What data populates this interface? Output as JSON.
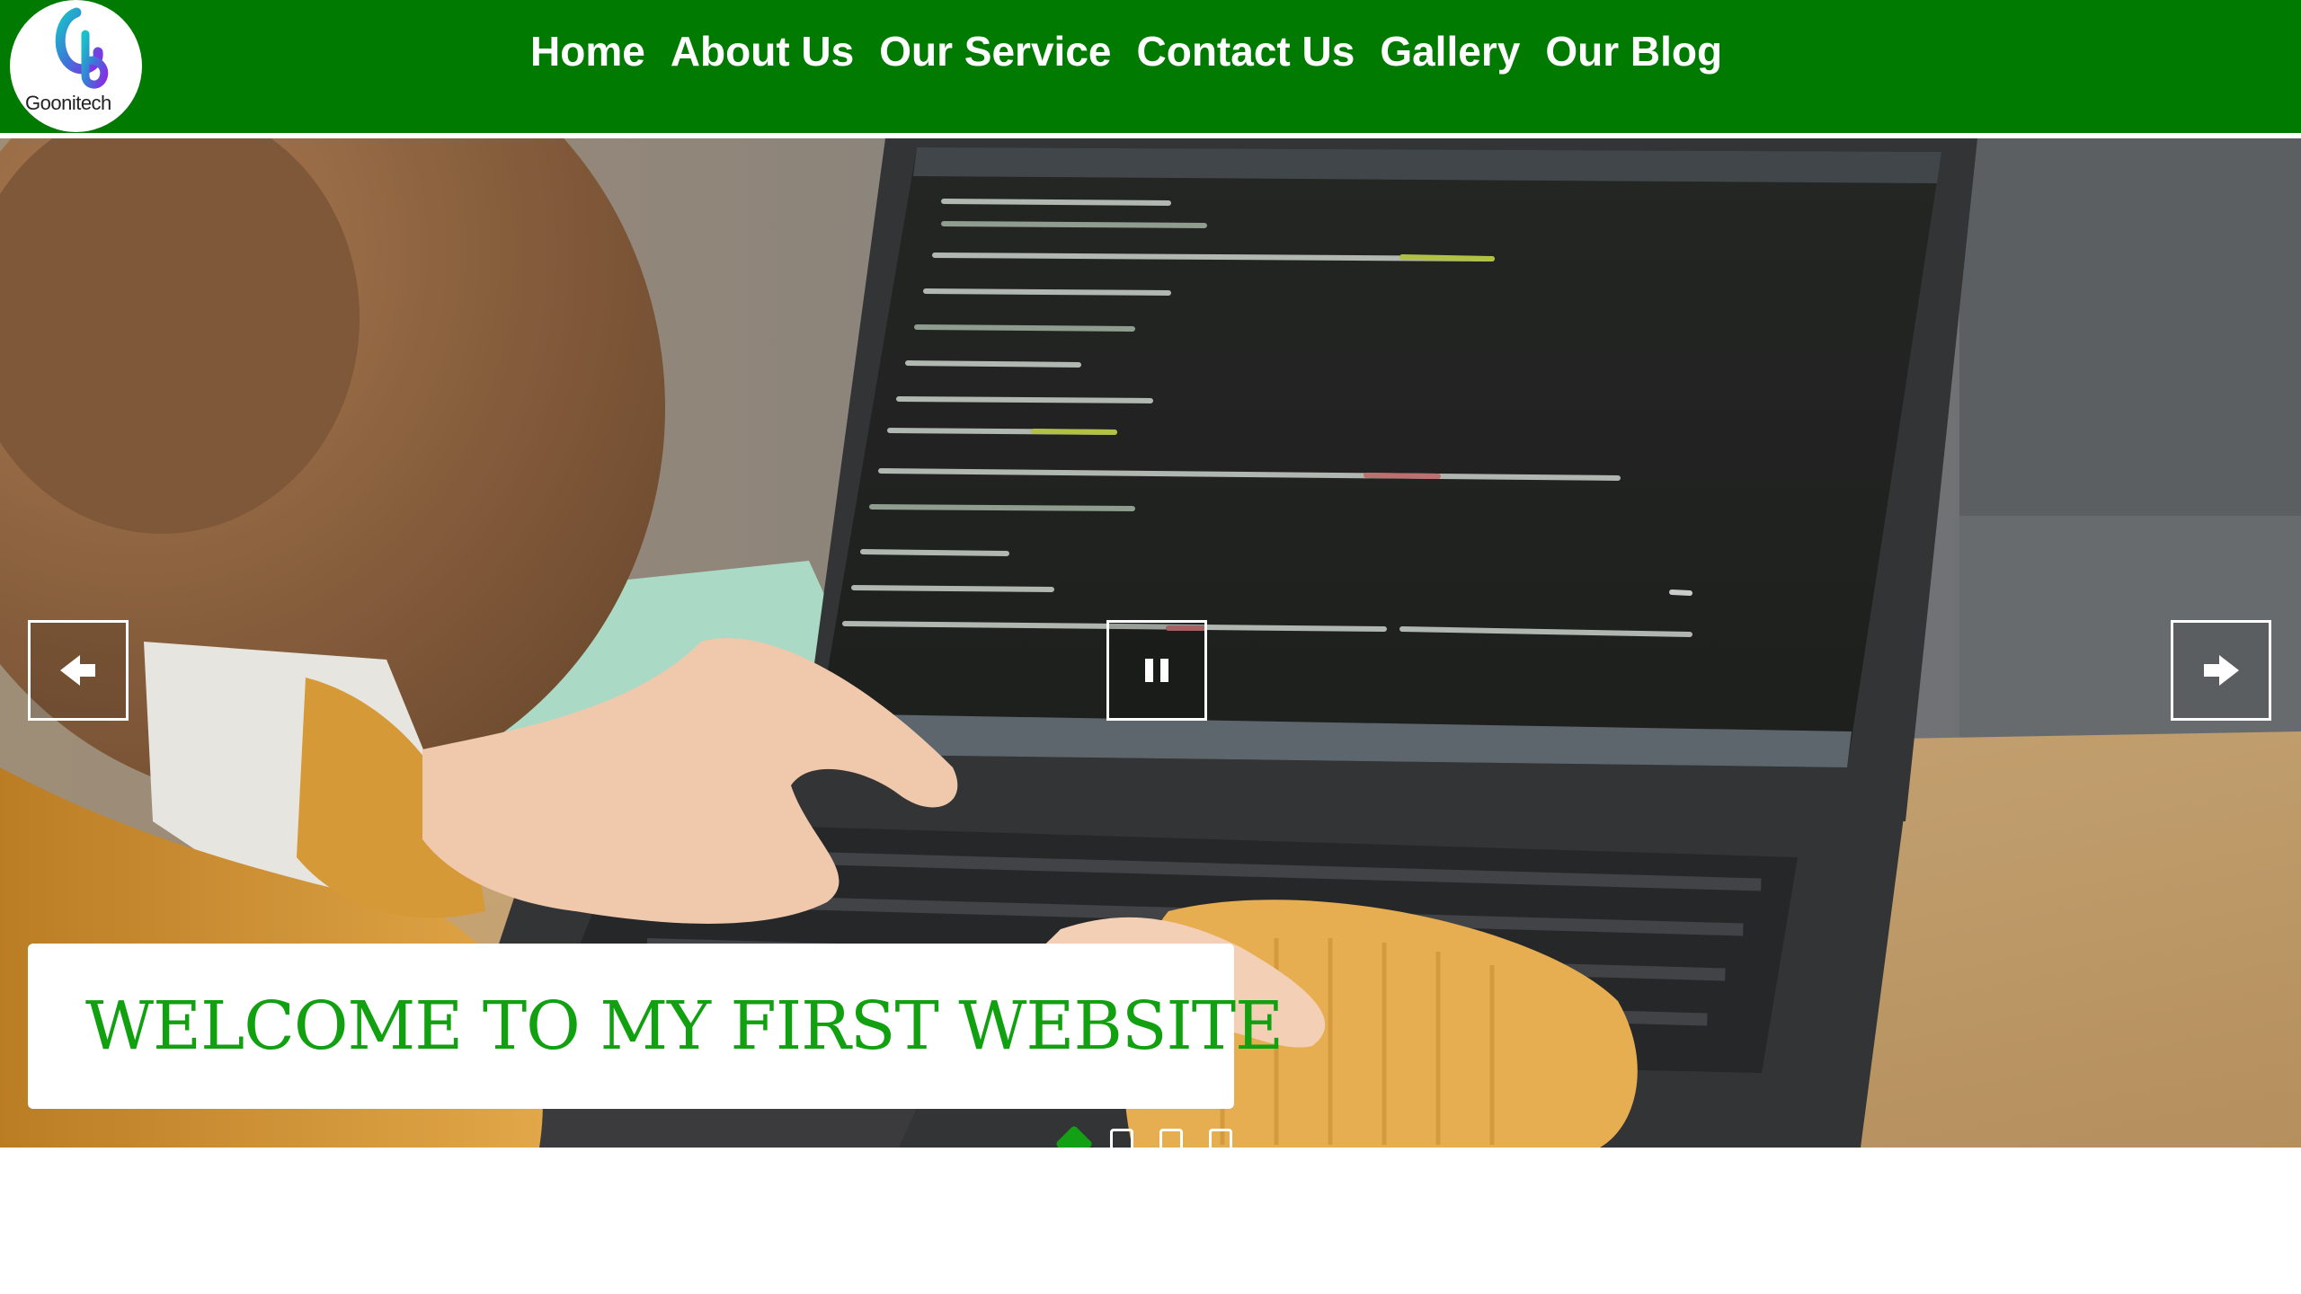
{
  "brand": {
    "logo_text": "Goonitech"
  },
  "nav": {
    "items": [
      {
        "label": "Home"
      },
      {
        "label": "About Us"
      },
      {
        "label": "Our Service"
      },
      {
        "label": "Contact Us"
      },
      {
        "label": "Gallery"
      },
      {
        "label": "Our Blog"
      }
    ]
  },
  "hero": {
    "caption": "WELCOME TO MY FIRST WEBSITE",
    "controls": {
      "prev_icon": "arrow-left-icon",
      "pause_icon": "pause-icon",
      "next_icon": "arrow-right-icon"
    },
    "slides_total": 4,
    "active_slide": 1
  },
  "colors": {
    "header_bg": "#007a00",
    "caption_text": "#10a010",
    "active_dot": "#14a014"
  }
}
